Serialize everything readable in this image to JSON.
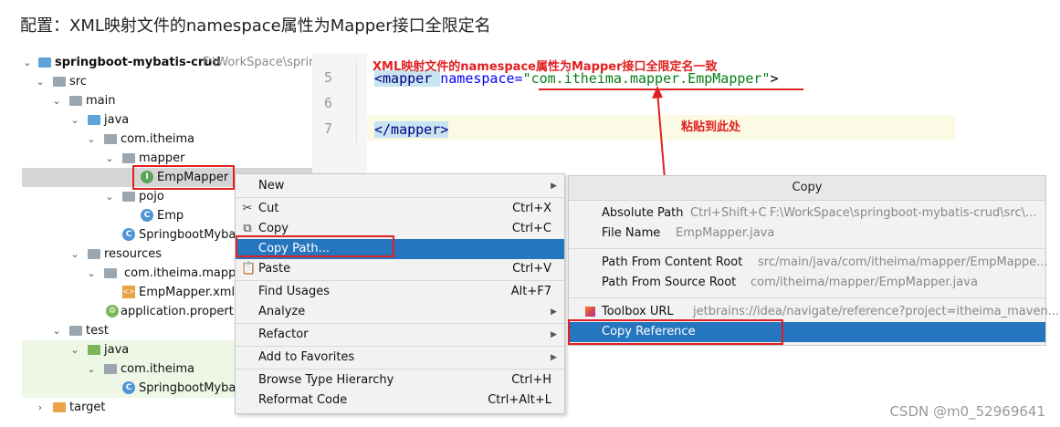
{
  "heading": "配置：XML映射文件的namespace属性为Mapper接口全限定名",
  "tree": {
    "project_name": "springboot-mybatis-crud",
    "project_path": "F:\\WorkSpace\\sprir",
    "items": [
      {
        "label": "src"
      },
      {
        "label": "main"
      },
      {
        "label": "java"
      },
      {
        "label": "com.itheima"
      },
      {
        "label": "mapper"
      },
      {
        "label": "EmpMapper"
      },
      {
        "label": "pojo"
      },
      {
        "label": "Emp"
      },
      {
        "label": "SpringbootMyba"
      },
      {
        "label": "resources"
      },
      {
        "label": "com.itheima.mappe"
      },
      {
        "label": "EmpMapper.xml"
      },
      {
        "label": "application.properti"
      },
      {
        "label": "test"
      },
      {
        "label": "java"
      },
      {
        "label": "com.itheima"
      },
      {
        "label": "SpringbootMyba"
      },
      {
        "label": "target"
      }
    ]
  },
  "editor": {
    "line_numbers": [
      "5",
      "6",
      "7"
    ],
    "line5_tag_open": "<mapper ",
    "line5_attr": "namespace=",
    "line5_value": "\"com.itheima.mapper.EmpMapper\"",
    "line5_close": ">",
    "line7_tag": "</mapper>"
  },
  "annotations": {
    "top": "XML映射文件的namespace属性为Mapper接口全限定名一致",
    "paste": "粘贴到此处"
  },
  "context_menu": {
    "new": "New",
    "cut": "Cut",
    "cut_key": "Ctrl+X",
    "copy": "Copy",
    "copy_key": "Ctrl+C",
    "copy_path": "Copy Path...",
    "paste": "Paste",
    "paste_key": "Ctrl+V",
    "find_usages": "Find Usages",
    "find_usages_key": "Alt+F7",
    "analyze": "Analyze",
    "refactor": "Refactor",
    "add_favorites": "Add to Favorites",
    "browse_hierarchy": "Browse Type Hierarchy",
    "browse_hierarchy_key": "Ctrl+H",
    "reformat": "Reformat Code",
    "reformat_key": "Ctrl+Alt+L"
  },
  "copy_popup": {
    "title": "Copy",
    "absolute_path": "Absolute Path",
    "absolute_path_key": "Ctrl+Shift+C",
    "absolute_path_value": "F:\\WorkSpace\\springboot-mybatis-crud\\src\\...",
    "file_name": "File Name",
    "file_name_value": "EmpMapper.java",
    "content_root": "Path From Content Root",
    "content_root_value": "src/main/java/com/itheima/mapper/EmpMappe...",
    "source_root": "Path From Source Root",
    "source_root_value": "com/itheima/mapper/EmpMapper.java",
    "toolbox_url": "Toolbox URL",
    "toolbox_url_value": "jetbrains://idea/navigate/reference?project=itheima_maven...",
    "copy_reference": "Copy Reference"
  },
  "watermark": "CSDN @m0_52969641",
  "colors": {
    "selection": "#2675bf",
    "annotation_red": "#e02020",
    "xml_tag": "#000080",
    "xml_attr": "#0000ff",
    "xml_value": "#067d17"
  }
}
